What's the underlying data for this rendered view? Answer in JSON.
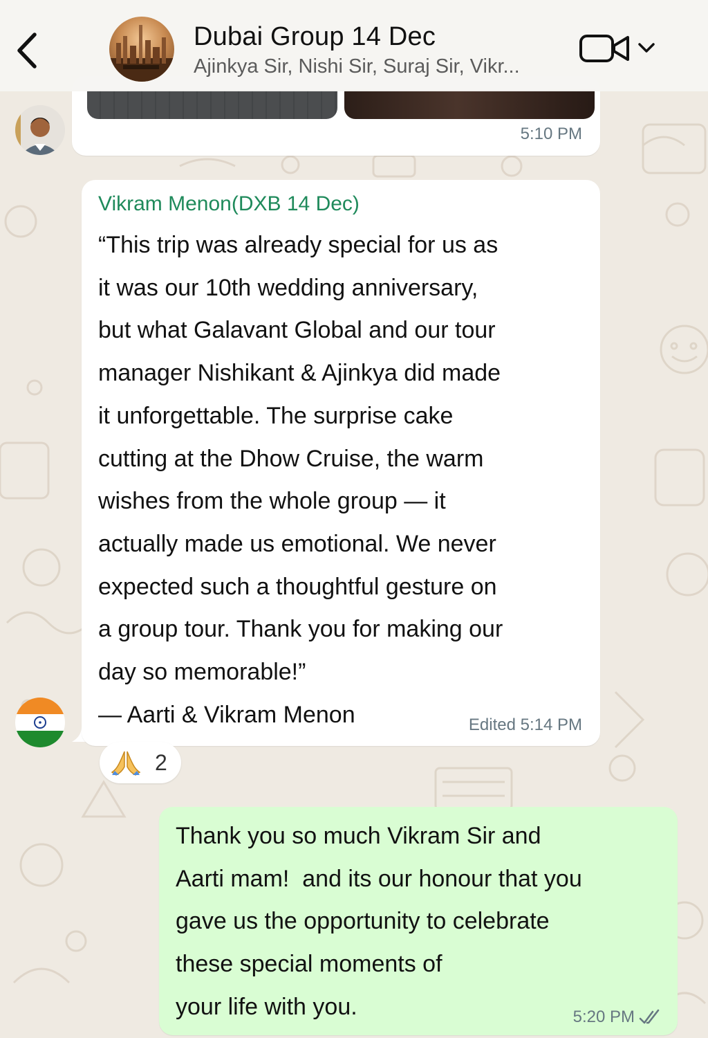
{
  "header": {
    "title": "Dubai Group 14 Dec",
    "subtitle": "Ajinkya Sir, Nishi Sir, Suraj Sir, Vikr...",
    "back_icon": "chevron-left-icon",
    "video_icon": "video-camera-icon",
    "dropdown_icon": "chevron-down-icon"
  },
  "messages": {
    "previous": {
      "time": "5:10 PM"
    },
    "incoming": {
      "sender": "Vikram Menon(DXB 14 Dec)",
      "lines": [
        "“This trip was already special for us as",
        "it was our 10th wedding anniversary,",
        "but what Galavant Global and our tour",
        "manager Nishikant & Ajinkya did made",
        "it unforgettable. The surprise cake",
        "cutting at the Dhow Cruise, the warm",
        "wishes from the whole group — it",
        "actually made us emotional. We never",
        "expected such a thoughtful gesture on",
        "a group tour. Thank you for making our",
        "day so memorable!”",
        "— Aarti & Vikram Menon"
      ],
      "meta": "Edited 5:14 PM",
      "reaction": {
        "emoji": "folded-hands-icon",
        "count": "2"
      }
    },
    "outgoing": {
      "lines": [
        "Thank you so much Vikram Sir and",
        "Aarti mam!  and its our honour that you",
        "gave us the opportunity to celebrate",
        "these special moments of",
        "your life with you."
      ],
      "time": "5:20 PM",
      "status_icon": "double-check-icon"
    }
  },
  "colors": {
    "background": "#efeae2",
    "incoming_bubble": "#ffffff",
    "outgoing_bubble": "#d9fdd3",
    "sender_name": "#1f8a5b",
    "meta_text": "#667781"
  }
}
